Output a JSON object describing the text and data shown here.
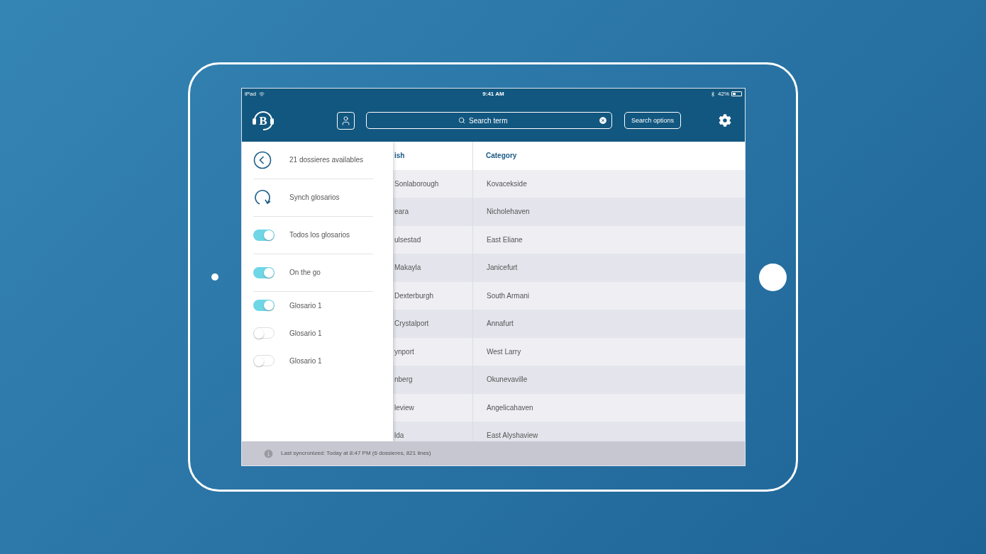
{
  "status_bar": {
    "carrier": "iPad",
    "time": "9:41 AM",
    "battery": "42%"
  },
  "header": {
    "logo": "B",
    "search": {
      "placeholder": "Search term"
    },
    "search_options": "Search options"
  },
  "sidebar": {
    "items": [
      {
        "kind": "back",
        "label": "21 dossieres availables"
      },
      {
        "kind": "sync",
        "label": "Synch glosarios"
      },
      {
        "kind": "toggle",
        "label": "Todos los glosarios",
        "on": true,
        "divider": true
      },
      {
        "kind": "toggle",
        "label": "On the go",
        "on": true,
        "divider": true
      },
      {
        "kind": "toggle",
        "label": "Glosario 1",
        "on": true,
        "divider": false
      },
      {
        "kind": "toggle",
        "label": "Glosario 1",
        "on": false,
        "divider": false
      },
      {
        "kind": "toggle",
        "label": "Glosario 1",
        "on": false,
        "divider": false
      }
    ]
  },
  "table": {
    "columns": [
      "ish",
      "Category"
    ],
    "rows": [
      [
        "Sonlaborough",
        "Kovacekside"
      ],
      [
        "eara",
        "Nicholehaven"
      ],
      [
        "ulsestad",
        "East Eliane"
      ],
      [
        "Makayla",
        "Janicefurt"
      ],
      [
        "Dexterburgh",
        "South Armani"
      ],
      [
        "Crystalport",
        "Annafurt"
      ],
      [
        "ynport",
        "West Larry"
      ],
      [
        "nberg",
        "Okunevaville"
      ],
      [
        "leview",
        "Angelicahaven"
      ],
      [
        "lda",
        "East Alyshaview"
      ]
    ]
  },
  "footer": {
    "text": "Last syncronized: Today at 8:47 PM (6 dossieres, 821 lines)"
  }
}
